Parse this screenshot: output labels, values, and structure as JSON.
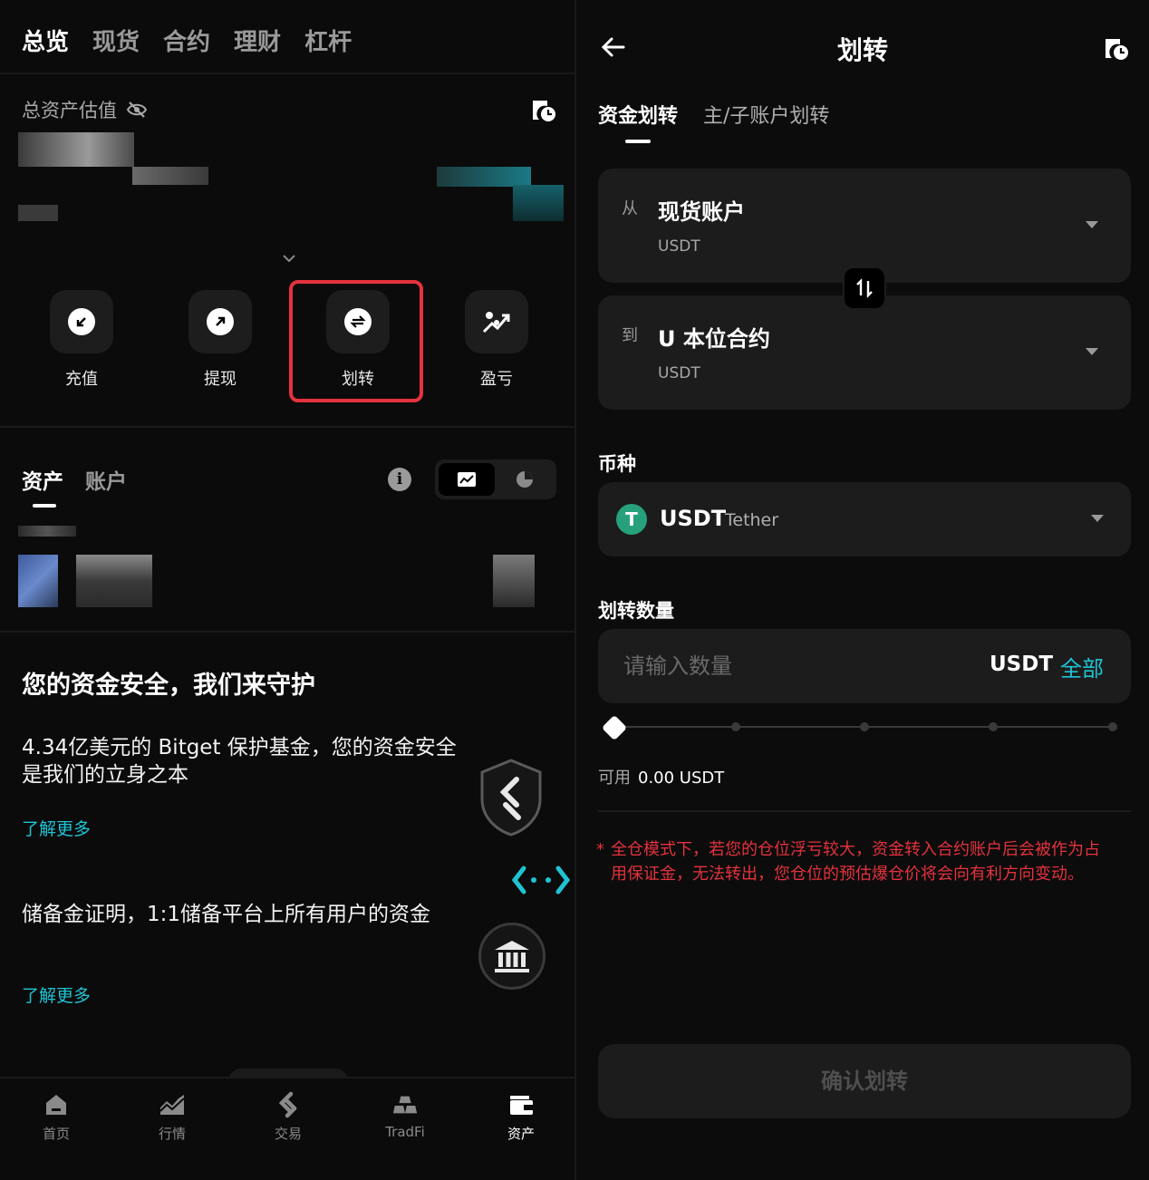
{
  "left": {
    "top_tabs": [
      "总览",
      "现货",
      "合约",
      "理财",
      "杠杆"
    ],
    "total_asset_label": "总资产估值",
    "actions": [
      {
        "label": "充值",
        "icon": "deposit-icon"
      },
      {
        "label": "提现",
        "icon": "withdraw-icon"
      },
      {
        "label": "划转",
        "icon": "transfer-icon"
      },
      {
        "label": "盈亏",
        "icon": "pnl-icon"
      }
    ],
    "highlight_color": "#e5323d",
    "sub_tabs": [
      "资产",
      "账户"
    ],
    "security": {
      "title": "您的资金安全，我们来守护",
      "fund_text": "4.34亿美元的 Bitget 保护基金，您的资金安全是我们的立身之本",
      "learn_more_1": "了解更多",
      "reserve_text": "储备金证明，1:1储备平台上所有用户的资金",
      "learn_more_2": "了解更多"
    },
    "bottom_nav": [
      {
        "label": "首页",
        "icon": "home-icon"
      },
      {
        "label": "行情",
        "icon": "market-icon"
      },
      {
        "label": "交易",
        "icon": "trade-icon"
      },
      {
        "label": "TradFi",
        "icon": "tradfi-icon"
      },
      {
        "label": "资产",
        "icon": "wallet-icon",
        "active": true
      }
    ]
  },
  "right": {
    "title": "划转",
    "tabs": [
      "资金划转",
      "主/子账户划转"
    ],
    "from": {
      "prefix": "从",
      "account": "现货账户",
      "coin": "USDT"
    },
    "to": {
      "prefix": "到",
      "account": "U 本位合约",
      "coin": "USDT"
    },
    "coin_label": "币种",
    "coin": {
      "code": "USDT",
      "name": "Tether",
      "logo_letter": "T",
      "logo_color": "#26a17b"
    },
    "amount_label": "划转数量",
    "amount_placeholder": "请输入数量",
    "amount_unit": "USDT",
    "amount_all": "全部",
    "slider_percent": 0,
    "available_label": "可用",
    "available_value": "0.00 USDT",
    "warning_star": "*",
    "warning": "全仓模式下，若您的仓位浮亏较大，资金转入合约账户后会被作为占用保证金，无法转出，您仓位的预估爆仓价将会向有利方向变动。",
    "confirm_label": "确认划转",
    "accent_color": "#1fc4d4"
  }
}
